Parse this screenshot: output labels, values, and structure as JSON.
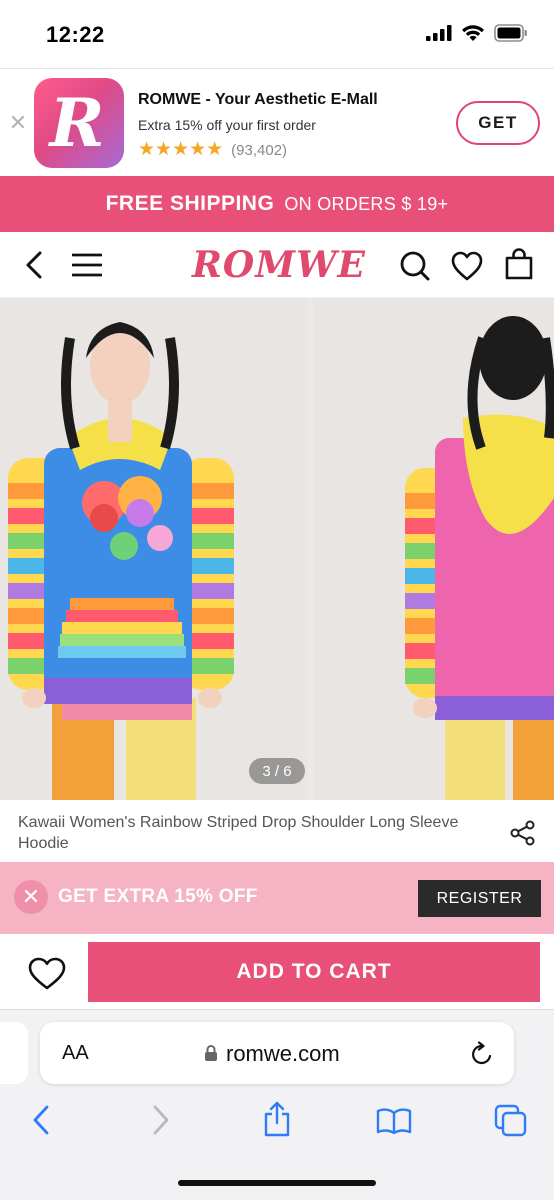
{
  "status_bar": {
    "time": "12:22"
  },
  "app_banner": {
    "app_name": "ROMWE - Your Aesthetic E-Mall",
    "subtitle": "Extra 15% off your first order",
    "stars": "★★★★★",
    "rating_count": "(93,402)",
    "get_label": "GET",
    "icon_letter": "R"
  },
  "shipping": {
    "strong": "FREE SHIPPING",
    "light": "ON ORDERS $ 19+"
  },
  "nav": {
    "logo": "ROMWE"
  },
  "gallery": {
    "page_indicator": "3 / 6"
  },
  "product": {
    "title": "Kawaii Women's Rainbow Striped Drop Shoulder Long Sleeve Hoodie"
  },
  "promo": {
    "text": "GET EXTRA 15% OFF",
    "register_label": "REGISTER"
  },
  "cart": {
    "add_label": "ADD TO CART"
  },
  "safari": {
    "aa_label": "AA",
    "url": "romwe.com"
  },
  "colors": {
    "brand_pink": "#e8507a",
    "promo_pink": "#f5b3c3",
    "star": "#f5a623",
    "dark": "#2a2a2a"
  }
}
